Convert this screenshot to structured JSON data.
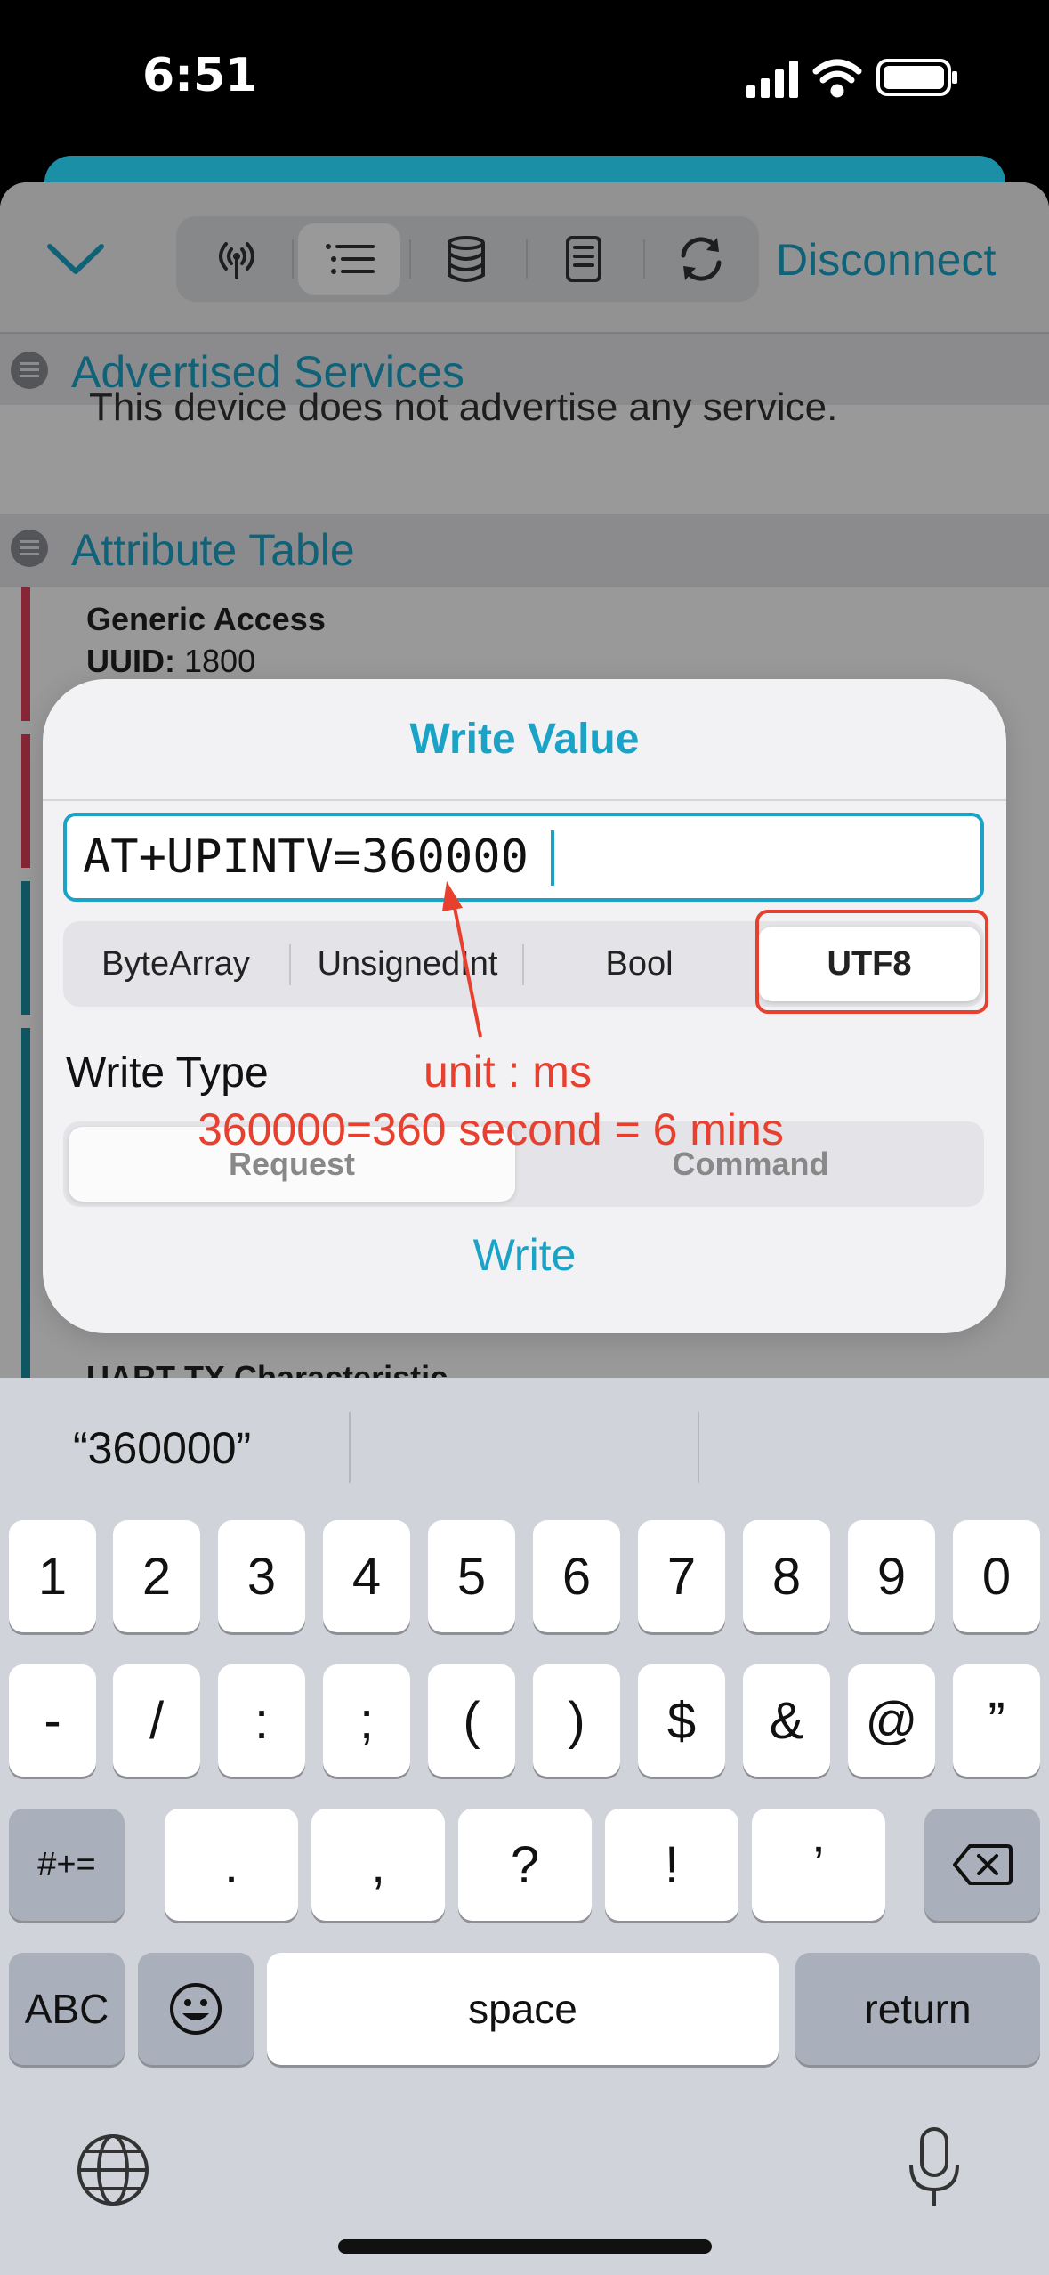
{
  "status_bar": {
    "time": "6:51"
  },
  "toolbar": {
    "disconnect_label": "Disconnect",
    "tools": [
      "antenna-icon",
      "list-icon",
      "database-icon",
      "document-icon",
      "refresh-icon"
    ],
    "selected_tool": "list-icon"
  },
  "sections": {
    "advertised_title": "Advertised Services",
    "advertised_text": "This device does not advertise any service.",
    "attribute_title": "Attribute Table",
    "service_name": "Generic Access",
    "service_uuid_label": "UUID:",
    "service_uuid_value": "1800",
    "peek_text": "UART TX Characteristic"
  },
  "dialog": {
    "title": "Write Value",
    "input_value": "AT+UPINTV=360000",
    "types": [
      "ByteArray",
      "UnsignedInt",
      "Bool",
      "UTF8"
    ],
    "selected_type": "UTF8",
    "write_type_label": "Write Type",
    "write_types": [
      "Request",
      "Command"
    ],
    "selected_write_type": "Request",
    "write_button": "Write"
  },
  "annotations": {
    "unit": "unit : ms",
    "calc": "360000=360 second = 6 mins",
    "color": "#e8402f"
  },
  "keyboard": {
    "prediction": "“360000”",
    "row1": [
      "1",
      "2",
      "3",
      "4",
      "5",
      "6",
      "7",
      "8",
      "9",
      "0"
    ],
    "row2": [
      "-",
      "/",
      ":",
      ";",
      "(",
      ")",
      "$",
      "&",
      "@",
      "”"
    ],
    "row3_left": "#+=",
    "row3": [
      ".",
      ",",
      "?",
      "!",
      "’"
    ],
    "abc": "ABC",
    "space": "space",
    "return": "return"
  },
  "colors": {
    "accent": "#1aa3c6",
    "annotation": "#e8402f"
  }
}
